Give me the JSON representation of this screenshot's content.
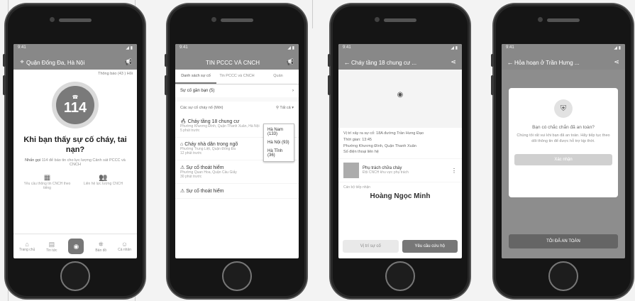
{
  "phones": [
    {
      "status": {
        "time": "9:41",
        "signal": "◢ ▮"
      },
      "appbar_title": "Quận Đống Đa, Hà Nội",
      "notifications_label": "Thông báo (43 ) Hỏi",
      "badge_number": "114",
      "headline": "Khi bạn thấy sự cố cháy, tai nạn?",
      "hint_prefix": "Nhấn gọi",
      "hint_text": "114 để báo tin cho lực lượng Cảnh sát PCCC và CNCH",
      "actions": [
        {
          "icon": "grid-icon",
          "label": "Yêu cầu thông tin CNCH theo tiếng"
        },
        {
          "icon": "users-icon",
          "label": "Liên hệ lực lượng CNCH"
        }
      ],
      "nav": [
        "Trang chủ",
        "Tin tức",
        "Phản ánh",
        "Bản đồ",
        "Cá nhân"
      ]
    },
    {
      "status": {
        "time": "9:41",
        "signal": "◢ ▮"
      },
      "appbar_title": "TIN PCCC VÀ CNCH",
      "tabs": [
        "Danh sách sự cố",
        "Tin PCCC và CNCH",
        "Quản"
      ],
      "filter_label": "Sự cố gần bạn (5)",
      "sort_label": "Các sự cố cháy nổ (Mới)",
      "sort_value": "Tất cả",
      "items": [
        {
          "title": "Cháy tầng 18 chung cư",
          "meta": "Phường Khương Đình, Quận Thanh Xuân, Hà Nội",
          "time": "5 phút trước"
        },
        {
          "title": "Cháy nhà dân trong ngõ",
          "meta": "Phường Trung Liệt, Quận Đống Đa",
          "time": "12 phút trước"
        },
        {
          "title": "Sự cố thoát hiểm",
          "meta": "Phường Quan Hoa, Quận Cầu Giấy",
          "time": "30 phút trước"
        },
        {
          "title": "Sự cố thoát hiểm",
          "meta": "",
          "time": ""
        }
      ],
      "popup_items": [
        "Hà Nam (133)",
        "Hà Nội (93)",
        "Hà Tĩnh (36)"
      ]
    },
    {
      "status": {
        "time": "9:41",
        "signal": "◢ ▮"
      },
      "appbar_title": "Cháy tầng 18 chung cư ...",
      "details": [
        "Vị trí xảy ra sự cố: 18A đường Trần Hưng Đạo",
        "Thời gian: 13:45",
        "Phường Khương Đình, Quận Thanh Xuân",
        "Số điện thoại liên hệ"
      ],
      "card_title": "Phụ trách chữa cháy",
      "card_desc": "Đội CNCH khu vực phụ trách",
      "responder_label": "Cán bộ tiếp nhận",
      "responder_name": "Hoàng Ngọc Minh",
      "btn_secondary": "Vị trí sự cố",
      "btn_primary": "Yêu cầu cứu hộ"
    },
    {
      "status": {
        "time": "9:41",
        "signal": "◢ ▮"
      },
      "appbar_title": "Hỏa hoạn ở Trần Hưng ...",
      "dialog_title": "Bạn có chắc chắn đã an toàn?",
      "dialog_body": "Chúng tôi rất vui khi bạn đã an toàn. Hãy tiếp tục theo dõi thông tin để được hỗ trợ kịp thời.",
      "dialog_btn": "Xác nhận",
      "bottom_btn": "TÔI ĐÃ AN TOÀN"
    }
  ]
}
